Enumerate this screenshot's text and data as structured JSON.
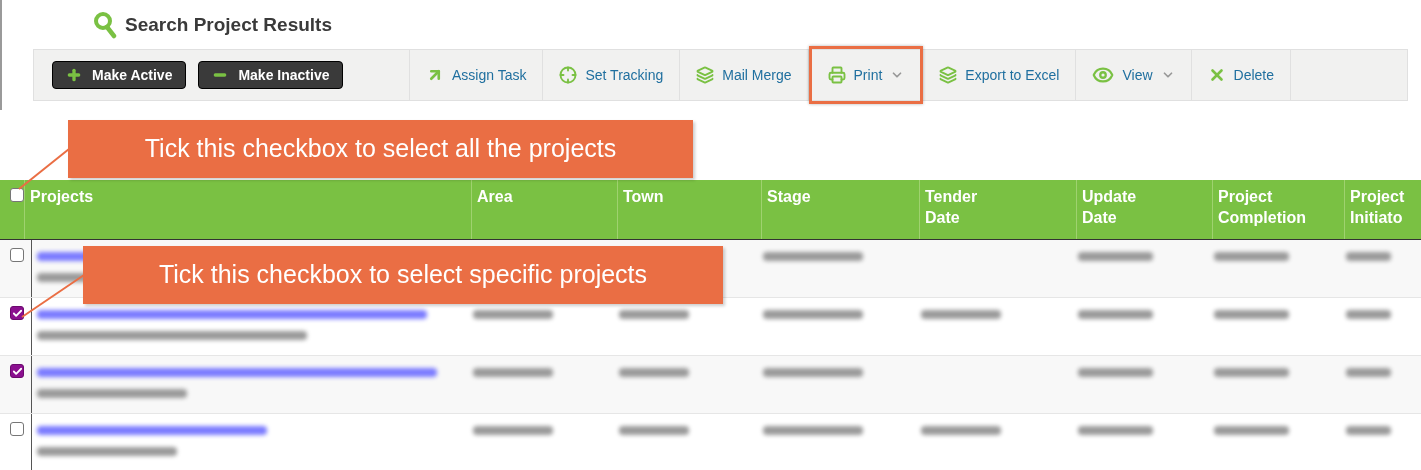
{
  "page": {
    "title": "Search Project Results"
  },
  "toolbar": {
    "buttons": [
      {
        "kind": "dark",
        "label": "Make Active"
      },
      {
        "kind": "dark",
        "label": "Make Inactive"
      },
      {
        "kind": "link",
        "label": "Assign Task",
        "dropdown": false,
        "highlighted": false
      },
      {
        "kind": "link",
        "label": "Set Tracking",
        "dropdown": false,
        "highlighted": false
      },
      {
        "kind": "link",
        "label": "Mail Merge",
        "dropdown": false,
        "highlighted": false
      },
      {
        "kind": "link",
        "label": "Print",
        "dropdown": true,
        "highlighted": true
      },
      {
        "kind": "link",
        "label": "Export to Excel",
        "dropdown": false,
        "highlighted": false
      },
      {
        "kind": "link",
        "label": "View",
        "dropdown": true,
        "highlighted": false
      },
      {
        "kind": "link",
        "label": "Delete",
        "dropdown": false,
        "highlighted": false
      }
    ]
  },
  "table": {
    "select_all_checked": false,
    "columns": [
      "Projects",
      "Area",
      "Town",
      "Stage",
      "Tender Date",
      "Update Date",
      "Project Completion",
      "Project Initiato"
    ],
    "rows": [
      {
        "checked": false,
        "tender_date_blurred": false
      },
      {
        "checked": true,
        "tender_date_blurred": true
      },
      {
        "checked": true,
        "tender_date_blurred": false
      },
      {
        "checked": false,
        "tender_date_blurred": true
      }
    ]
  },
  "callouts": [
    {
      "text": "Tick this checkbox to select all the projects"
    },
    {
      "text": "Tick this checkbox to select specific projects"
    }
  ]
}
